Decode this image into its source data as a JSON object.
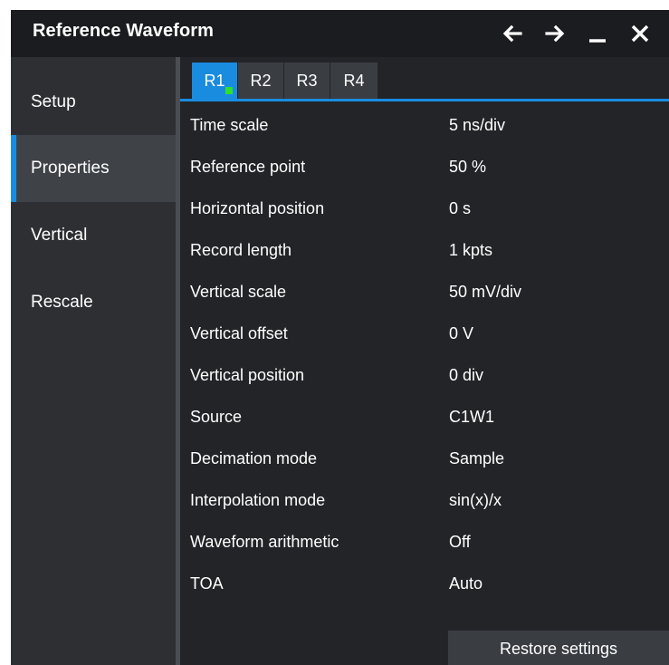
{
  "window": {
    "title": "Reference Waveform",
    "controls": {
      "back_icon": "arrow-left-icon",
      "forward_icon": "arrow-right-icon",
      "minimize_icon": "minimize-icon",
      "close_icon": "close-icon"
    }
  },
  "sidebar": {
    "items": [
      {
        "label": "Setup",
        "active": false
      },
      {
        "label": "Properties",
        "active": true
      },
      {
        "label": "Vertical",
        "active": false
      },
      {
        "label": "Rescale",
        "active": false
      }
    ]
  },
  "tabs": [
    {
      "label": "R1",
      "active": true,
      "indicator": true
    },
    {
      "label": "R2",
      "active": false
    },
    {
      "label": "R3",
      "active": false
    },
    {
      "label": "R4",
      "active": false
    }
  ],
  "properties": [
    {
      "label": "Time scale",
      "value": "5 ns/div"
    },
    {
      "label": "Reference point",
      "value": "50 %"
    },
    {
      "label": "Horizontal position",
      "value": "0 s"
    },
    {
      "label": "Record length",
      "value": "1 kpts"
    },
    {
      "label": "Vertical scale",
      "value": "50 mV/div"
    },
    {
      "label": "Vertical offset",
      "value": "0 V"
    },
    {
      "label": "Vertical position",
      "value": "0 div"
    },
    {
      "label": "Source",
      "value": "C1W1"
    },
    {
      "label": "Decimation mode",
      "value": "Sample"
    },
    {
      "label": "Interpolation mode",
      "value": "sin(x)/x"
    },
    {
      "label": "Waveform arithmetic",
      "value": "Off"
    },
    {
      "label": "TOA",
      "value": "Auto"
    }
  ],
  "restore_button": {
    "label": "Restore settings"
  },
  "colors": {
    "accent": "#1a8ce0",
    "indicator": "#2ee02e",
    "background": "#232428"
  }
}
